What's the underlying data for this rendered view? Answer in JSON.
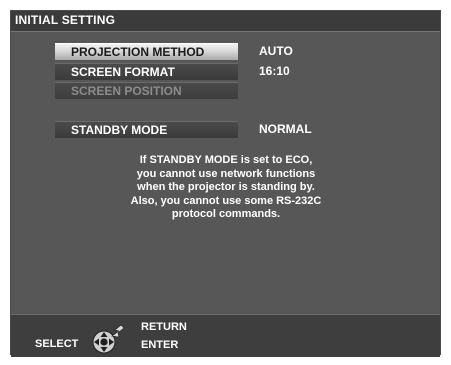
{
  "title": "INITIAL SETTING",
  "menu": [
    {
      "label": "PROJECTION METHOD",
      "value": "AUTO",
      "state": "selected"
    },
    {
      "label": "SCREEN FORMAT",
      "value": "16:10",
      "state": "normal"
    },
    {
      "label": "SCREEN POSITION",
      "value": "",
      "state": "disabled"
    },
    {
      "label": "STANDBY MODE",
      "value": "NORMAL",
      "state": "normal"
    }
  ],
  "notice": [
    "If STANDBY MODE is set to ECO,",
    "you cannot use network functions",
    "when the projector is standing by.",
    "Also, you cannot use some RS-232C",
    "protocol commands."
  ],
  "footer": {
    "select_label": "SELECT",
    "return_label": "RETURN",
    "enter_label": "ENTER",
    "icons": [
      "dpad-icon",
      "return-arrow-icon"
    ]
  },
  "colors": {
    "panel": "#575757",
    "title_bar": "#3b3b3b",
    "footer": "#3e3e3e",
    "selected_item": "#d8d8d8",
    "disabled_text": "#8c8c8c"
  }
}
